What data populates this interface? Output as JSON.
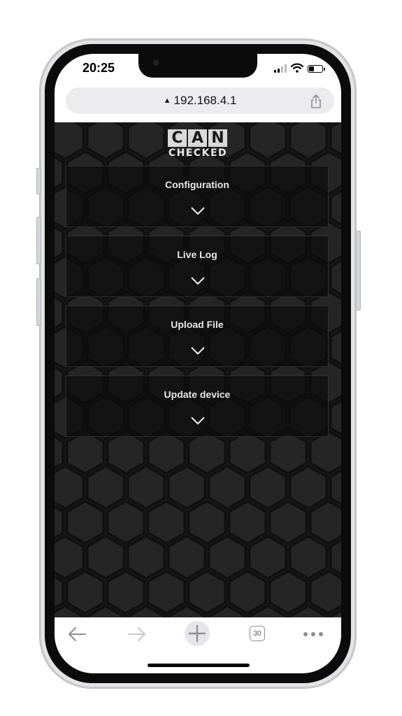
{
  "status_bar": {
    "time": "20:25"
  },
  "browser": {
    "url": "192.168.4.1",
    "security_icon": "warning-triangle-icon",
    "tab_count": "30"
  },
  "page": {
    "logo": {
      "top_letters": [
        "C",
        "A",
        "N"
      ],
      "bottom_text": "CHECKED"
    },
    "panels": [
      {
        "title": "Configuration"
      },
      {
        "title": "Live Log"
      },
      {
        "title": "Upload File"
      },
      {
        "title": "Update device"
      }
    ]
  },
  "colors": {
    "background": "#161616",
    "panel": "#0c0c0c",
    "panel_text": "#e8e8e8",
    "logo_box": "#d9d9d9"
  }
}
